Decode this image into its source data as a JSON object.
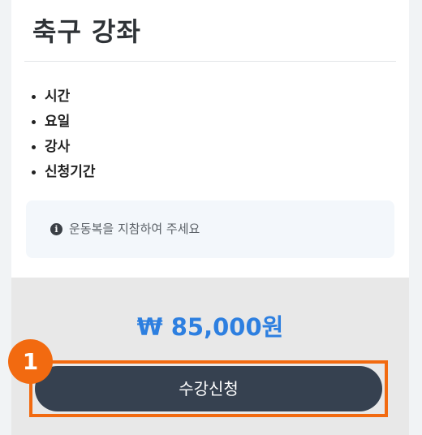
{
  "page": {
    "title": "축구 강좌"
  },
  "info_items": [
    {
      "label": "시간"
    },
    {
      "label": "요일"
    },
    {
      "label": "강사"
    },
    {
      "label": "신청기간"
    }
  ],
  "notice": {
    "icon": "info-icon",
    "text": "운동복을 지참하여 주세요"
  },
  "purchase": {
    "price": "₩ 85,000원",
    "apply_label": "수강신청"
  },
  "annotation": {
    "step_number": "1"
  },
  "colors": {
    "price": "#2d7fe0",
    "button": "#364150",
    "highlight": "#f26a10"
  }
}
